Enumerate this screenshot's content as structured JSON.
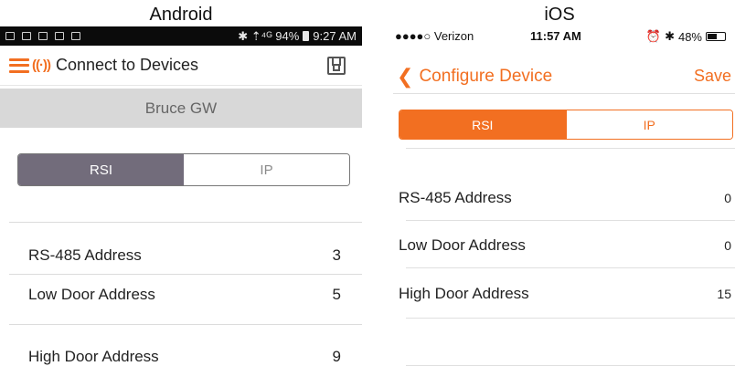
{
  "captions": {
    "android": "Android",
    "ios": "iOS"
  },
  "android": {
    "status_bar": {
      "right_text": "✱ ⇡⁴ᴳ 94%",
      "time": "9:27 AM"
    },
    "toolbar": {
      "title": "Connect to Devices",
      "logo_icon": "rsi-waves-icon",
      "save_icon": "floppy-disk-icon"
    },
    "device_name": "Bruce GW",
    "segments": [
      {
        "label": "RSI",
        "active": true
      },
      {
        "label": "IP",
        "active": false
      }
    ],
    "rows": [
      {
        "label": "RS-485 Address",
        "value": "3"
      },
      {
        "label": "Low Door Address",
        "value": "5"
      },
      {
        "label": "High Door Address",
        "value": "9"
      }
    ]
  },
  "ios": {
    "status_bar": {
      "carrier": "●●●●○ Verizon ",
      "time": "11:57 AM",
      "battery": "48%"
    },
    "nav": {
      "title": "Configure Device",
      "save_label": "Save",
      "back_icon": "chevron-left-icon"
    },
    "segments": [
      {
        "label": "RSI",
        "active": true
      },
      {
        "label": "IP",
        "active": false
      }
    ],
    "rows": [
      {
        "label": "RS-485 Address",
        "value": "0"
      },
      {
        "label": "Low Door Address",
        "value": "0"
      },
      {
        "label": "High Door Address",
        "value": "15"
      }
    ]
  },
  "colors": {
    "accent": "#f26f21",
    "android_segment_active": "#726c7b",
    "android_device_bar": "#d8d8d8"
  }
}
